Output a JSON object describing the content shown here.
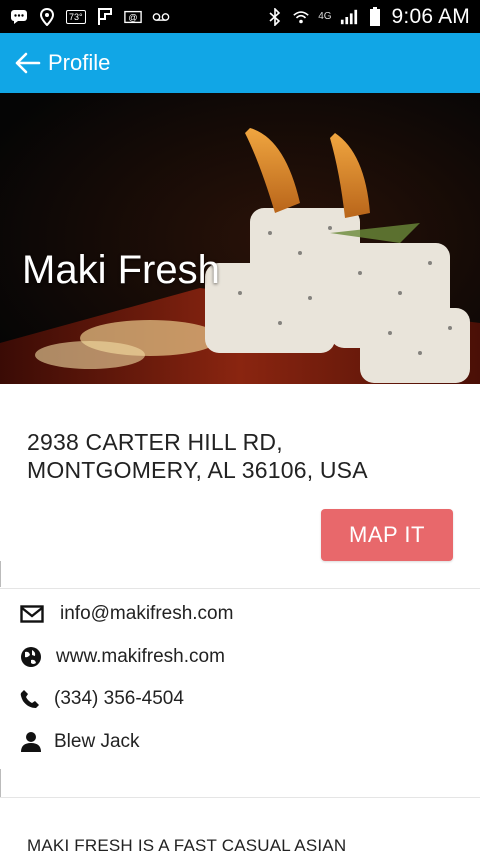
{
  "status_bar": {
    "temperature_badge": "73°",
    "network": "4G",
    "time": "9:06 AM"
  },
  "app_bar": {
    "title": "Profile"
  },
  "hero": {
    "title": "Maki Fresh"
  },
  "address": {
    "line1": "2938 CARTER HILL RD,",
    "line2": "MONTGOMERY, AL 36106, USA"
  },
  "map_button": {
    "label": "MAP IT"
  },
  "contact": {
    "email": "info@makifresh.com",
    "website": "www.makifresh.com",
    "phone": "(334) 356-4504",
    "person": "Blew Jack"
  },
  "description": {
    "text": "MAKI FRESH IS A FAST CASUAL ASIAN"
  },
  "colors": {
    "app_bar": "#11a6e6",
    "map_button": "#e8686b"
  }
}
